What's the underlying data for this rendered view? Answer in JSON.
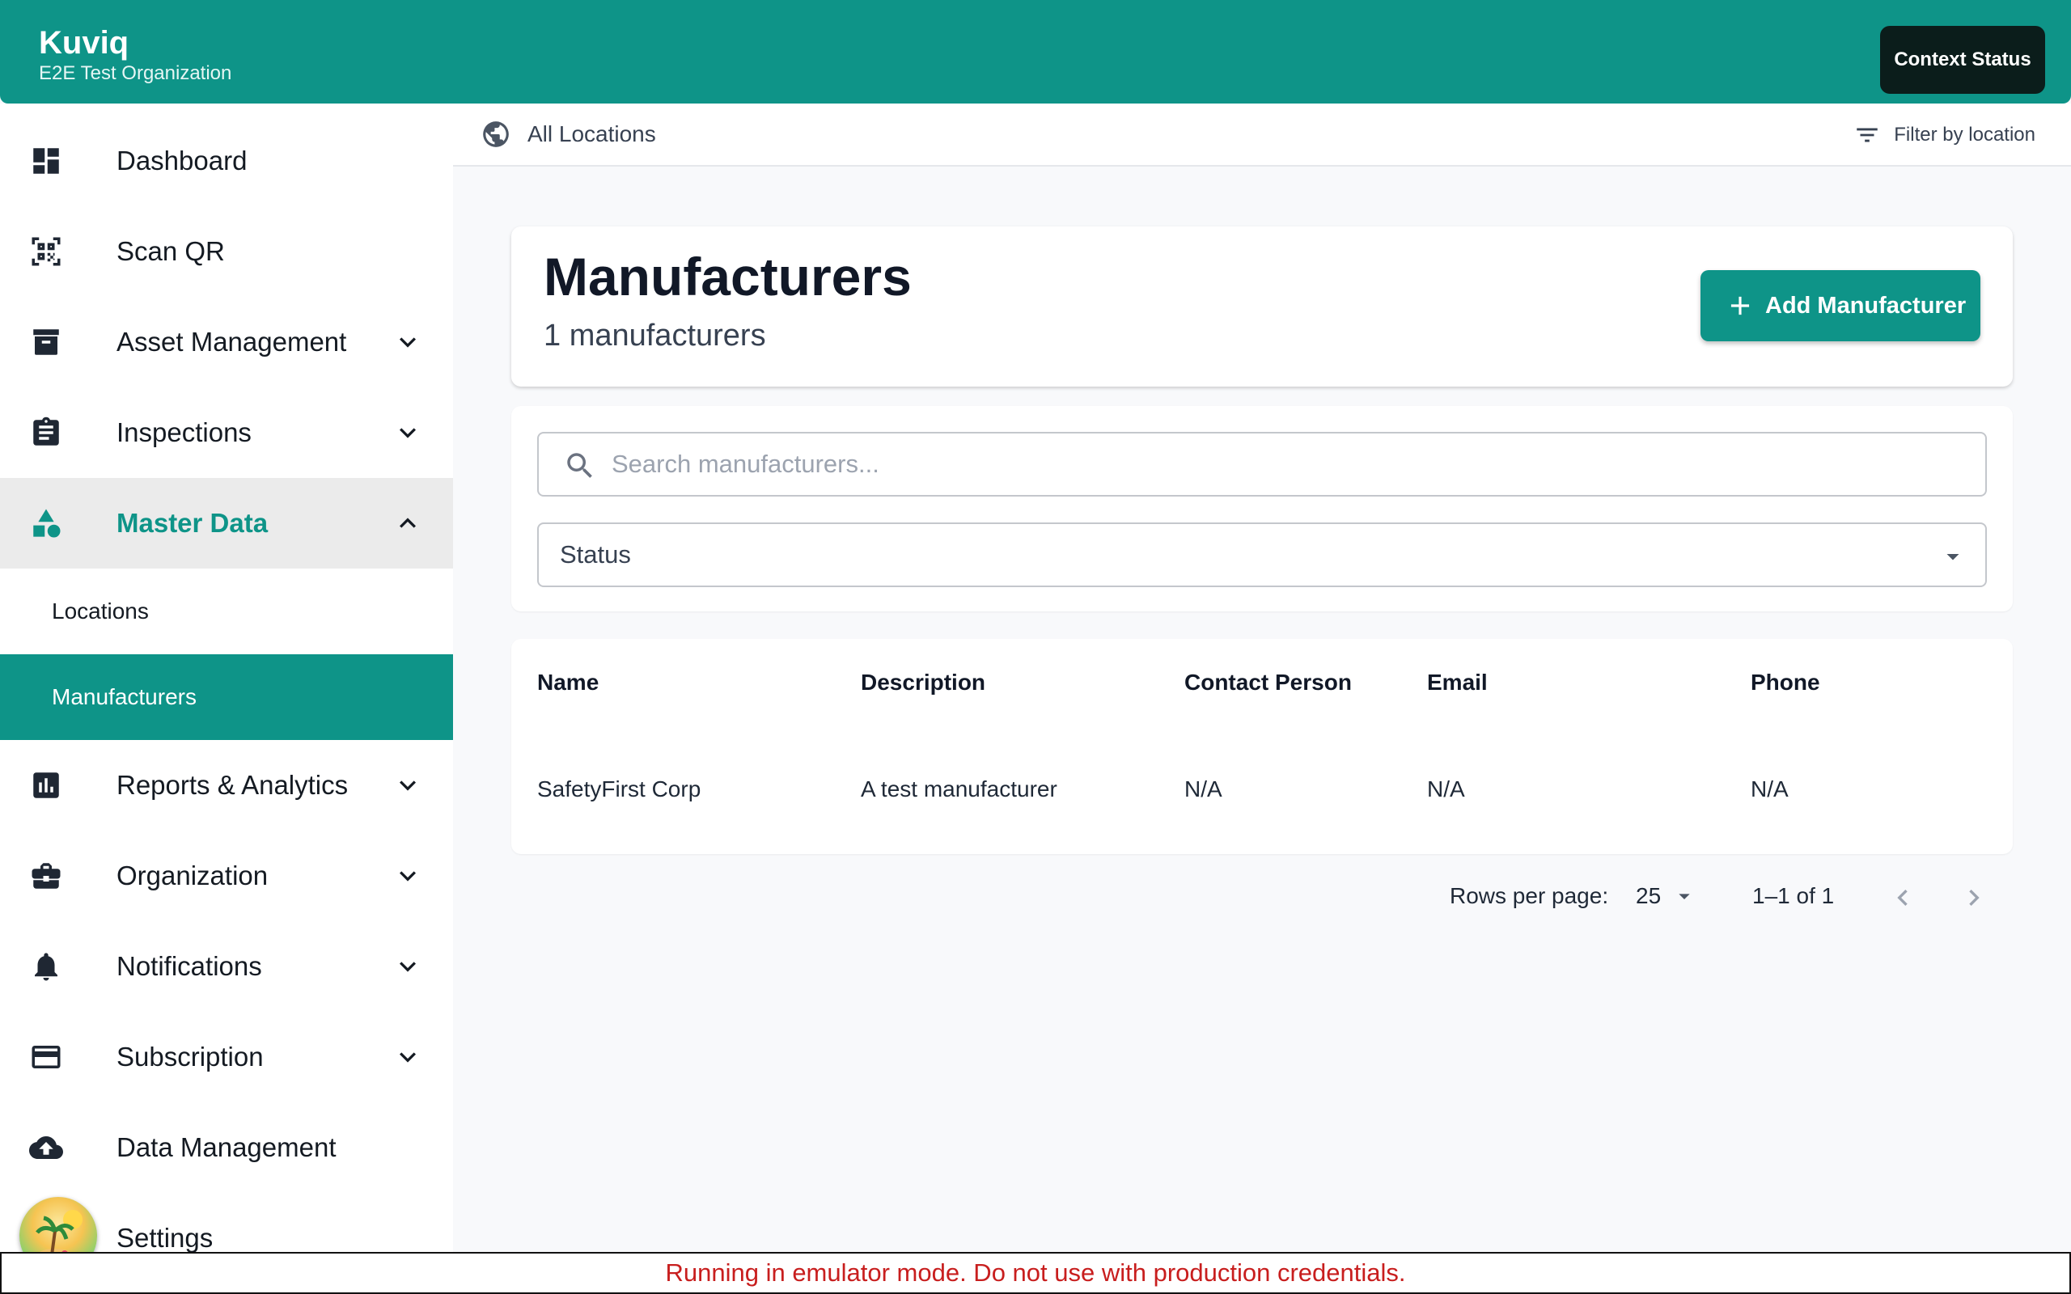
{
  "header": {
    "brand": "Kuviq",
    "organization": "E2E Test Organization",
    "context_button": "Context Status",
    "accent_color": "#0e9488"
  },
  "sidebar": {
    "items": [
      {
        "label": "Dashboard",
        "icon": "dashboard-icon"
      },
      {
        "label": "Scan QR",
        "icon": "qr-scan-icon"
      },
      {
        "label": "Asset Management",
        "icon": "archive-icon",
        "expandable": true
      },
      {
        "label": "Inspections",
        "icon": "clipboard-icon",
        "expandable": true
      },
      {
        "label": "Master Data",
        "icon": "shapes-icon",
        "expandable": true,
        "expanded": true,
        "active": true
      },
      {
        "label": "Reports & Analytics",
        "icon": "bar-chart-icon",
        "expandable": true
      },
      {
        "label": "Organization",
        "icon": "briefcase-icon",
        "expandable": true
      },
      {
        "label": "Notifications",
        "icon": "bell-icon",
        "expandable": true
      },
      {
        "label": "Subscription",
        "icon": "credit-card-icon",
        "expandable": true
      },
      {
        "label": "Data Management",
        "icon": "cloud-upload-icon"
      },
      {
        "label": "Settings",
        "icon": "settings-icon"
      }
    ],
    "master_data_children": [
      {
        "label": "Locations"
      },
      {
        "label": "Manufacturers",
        "selected": true
      }
    ]
  },
  "location_bar": {
    "current": "All Locations",
    "filter_label": "Filter by location"
  },
  "page": {
    "title": "Manufacturers",
    "count_text": "1 manufacturers",
    "add_button": "Add Manufacturer"
  },
  "filters": {
    "search_placeholder": "Search manufacturers...",
    "search_value": "",
    "status_label": "Status"
  },
  "table": {
    "columns": [
      "Name",
      "Description",
      "Contact Person",
      "Email",
      "Phone"
    ],
    "rows": [
      [
        "SafetyFirst Corp",
        "A test manufacturer",
        "N/A",
        "N/A",
        "N/A"
      ]
    ]
  },
  "pagination": {
    "rows_per_page_label": "Rows per page:",
    "rows_per_page": "25",
    "range": "1–1 of 1"
  },
  "banner": {
    "text": "Running in emulator mode. Do not use with production credentials.",
    "color": "#c81e1e"
  }
}
